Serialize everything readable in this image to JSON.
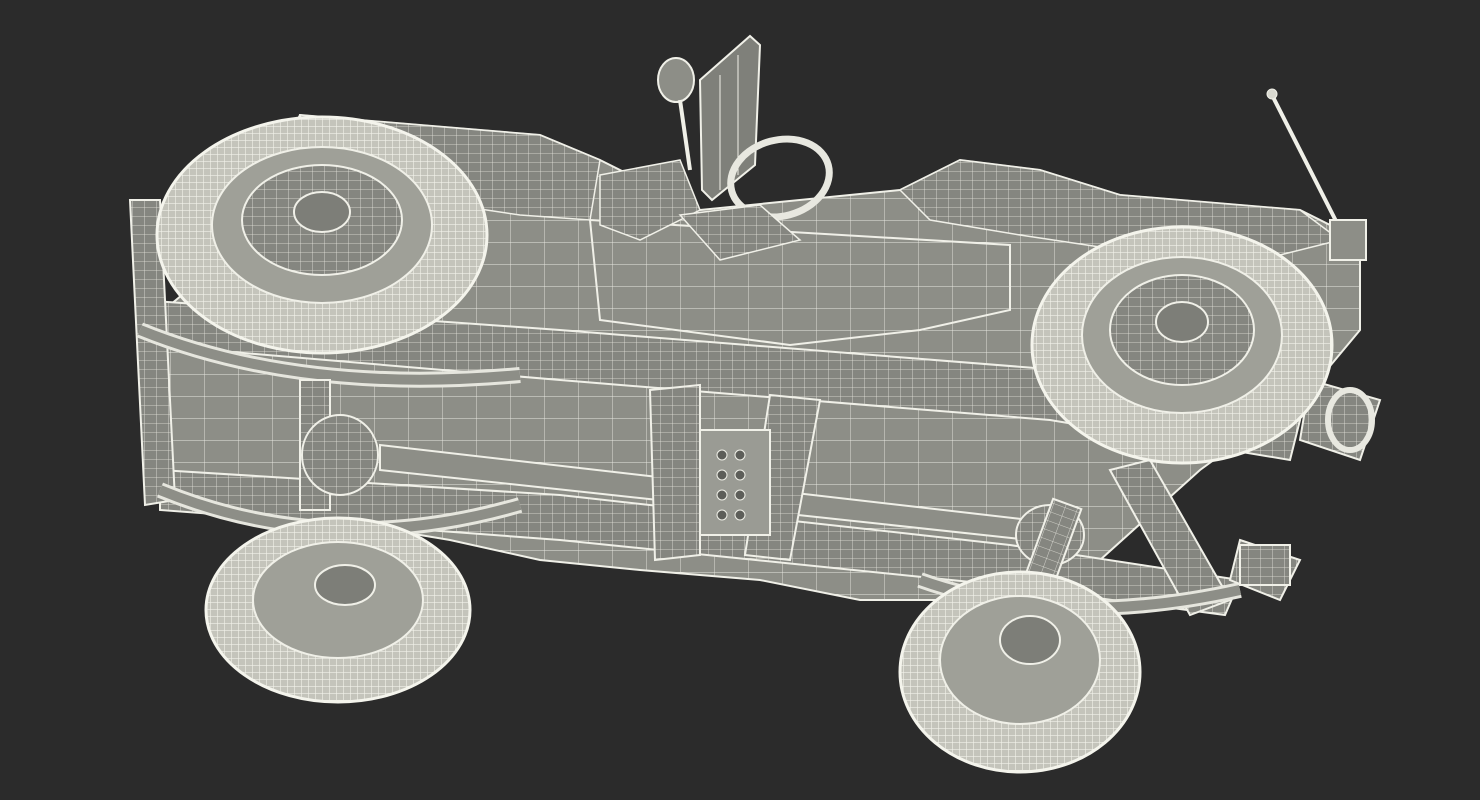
{
  "scene": {
    "subject": "off-road-vehicle-wireframe-underside",
    "colors": {
      "background": "#2b2b2b",
      "body_fill": "#8e8f88",
      "body_shadow": "#6f706a",
      "wire": "#ecece4",
      "tire_fill": "#c9c9c0",
      "hub_fill": "#7d7e78"
    }
  }
}
